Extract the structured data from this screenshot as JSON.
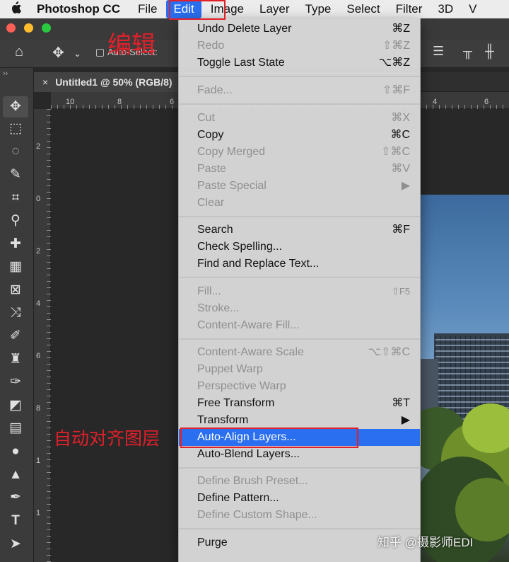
{
  "menubar": {
    "apple": "",
    "app_name": "Photoshop CC",
    "items": [
      "File",
      "Edit",
      "Image",
      "Layer",
      "Type",
      "Select",
      "Filter",
      "3D",
      "V"
    ]
  },
  "options_bar": {
    "auto_select_label": "Auto-Select:"
  },
  "document_tab": {
    "close": "×",
    "title": "Untitled1 @ 50% (RGB/8)"
  },
  "rulers": {
    "top_labels": [
      "10",
      "8",
      "6",
      "4",
      "6"
    ],
    "left_labels": [
      "2",
      "0",
      "2",
      "4",
      "6",
      "8",
      "1",
      "1"
    ]
  },
  "edit_menu": {
    "groups": [
      [
        {
          "label": "Undo Delete Layer",
          "shortcut": "⌘Z",
          "enabled": true
        },
        {
          "label": "Redo",
          "shortcut": "⇧⌘Z",
          "enabled": false
        },
        {
          "label": "Toggle Last State",
          "shortcut": "⌥⌘Z",
          "enabled": true
        }
      ],
      [
        {
          "label": "Fade...",
          "shortcut": "⇧⌘F",
          "enabled": false
        }
      ],
      [
        {
          "label": "Cut",
          "shortcut": "⌘X",
          "enabled": false
        },
        {
          "label": "Copy",
          "shortcut": "⌘C",
          "enabled": true
        },
        {
          "label": "Copy Merged",
          "shortcut": "⇧⌘C",
          "enabled": false
        },
        {
          "label": "Paste",
          "shortcut": "⌘V",
          "enabled": false
        },
        {
          "label": "Paste Special",
          "shortcut": "▶",
          "enabled": false
        },
        {
          "label": "Clear",
          "shortcut": "",
          "enabled": false
        }
      ],
      [
        {
          "label": "Search",
          "shortcut": "⌘F",
          "enabled": true
        },
        {
          "label": "Check Spelling...",
          "shortcut": "",
          "enabled": true
        },
        {
          "label": "Find and Replace Text...",
          "shortcut": "",
          "enabled": true
        }
      ],
      [
        {
          "label": "Fill...",
          "shortcut": "⇧F5",
          "enabled": false
        },
        {
          "label": "Stroke...",
          "shortcut": "",
          "enabled": false
        },
        {
          "label": "Content-Aware Fill...",
          "shortcut": "",
          "enabled": false
        }
      ],
      [
        {
          "label": "Content-Aware Scale",
          "shortcut": "⌥⇧⌘C",
          "enabled": false
        },
        {
          "label": "Puppet Warp",
          "shortcut": "",
          "enabled": false
        },
        {
          "label": "Perspective Warp",
          "shortcut": "",
          "enabled": false
        },
        {
          "label": "Free Transform",
          "shortcut": "⌘T",
          "enabled": true
        },
        {
          "label": "Transform",
          "shortcut": "▶",
          "enabled": true
        },
        {
          "label": "Auto-Align Layers...",
          "shortcut": "",
          "enabled": true,
          "highlighted": true
        },
        {
          "label": "Auto-Blend Layers...",
          "shortcut": "",
          "enabled": true
        }
      ],
      [
        {
          "label": "Define Brush Preset...",
          "shortcut": "",
          "enabled": false
        },
        {
          "label": "Define Pattern...",
          "shortcut": "",
          "enabled": true
        },
        {
          "label": "Define Custom Shape...",
          "shortcut": "",
          "enabled": false
        }
      ],
      [
        {
          "label": "Purge",
          "shortcut": "",
          "enabled": true
        }
      ]
    ]
  },
  "annotations": {
    "edit_label": "编辑",
    "auto_align_label": "自动对齐图层"
  },
  "watermark": "知乎 @摄影师EDI",
  "colors": {
    "menu_highlight": "#2a6ff0",
    "annotation_red": "#e2202a",
    "traffic_close": "#fe5f57",
    "traffic_min": "#febc2e",
    "traffic_max": "#28c840"
  },
  "tools": [
    "move-tool-icon",
    "marquee-tool-icon",
    "lasso-tool-icon",
    "quick-selection-tool-icon",
    "crop-tool-icon",
    "eyedropper-tool-icon",
    "healing-brush-tool-icon",
    "bandaid-tool-icon",
    "frame-tool-icon",
    "content-aware-move-tool-icon",
    "brush-tool-icon",
    "clone-stamp-tool-icon",
    "history-brush-tool-icon",
    "eraser-tool-icon",
    "gradient-tool-icon",
    "blur-tool-icon",
    "dodge-tool-icon",
    "pen-tool-icon",
    "type-tool-icon",
    "path-selection-tool-icon"
  ]
}
